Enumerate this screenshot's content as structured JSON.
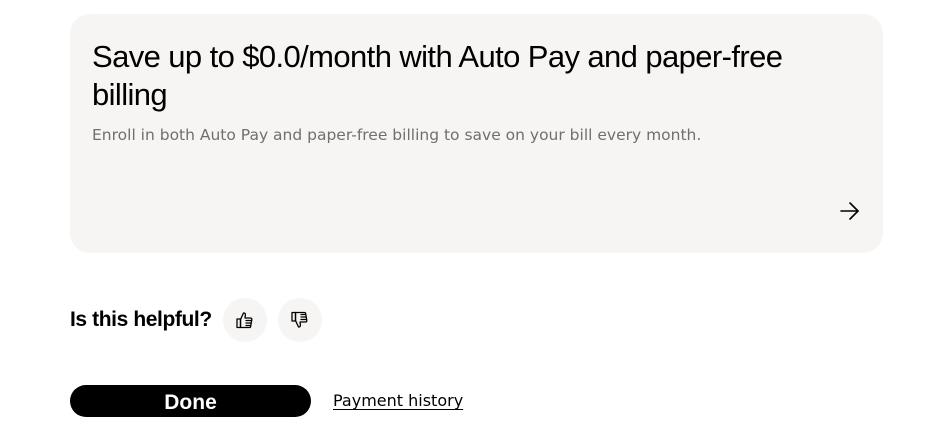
{
  "promo_card": {
    "title": "Save up to $0.0/month with Auto Pay and paper-free billing",
    "subtitle": "Enroll in both Auto Pay and paper-free billing to save on your bill every month.",
    "arrow_icon": "arrow-right-icon"
  },
  "feedback": {
    "question": "Is this helpful?",
    "thumbs_up_icon": "thumbs-up-icon",
    "thumbs_down_icon": "thumbs-down-icon"
  },
  "actions": {
    "done_label": "Done",
    "payment_history_label": "Payment history"
  },
  "colors": {
    "card_background": "#f6f5f3",
    "primary_button": "#000000",
    "subtitle_text": "#6f6f6f"
  }
}
